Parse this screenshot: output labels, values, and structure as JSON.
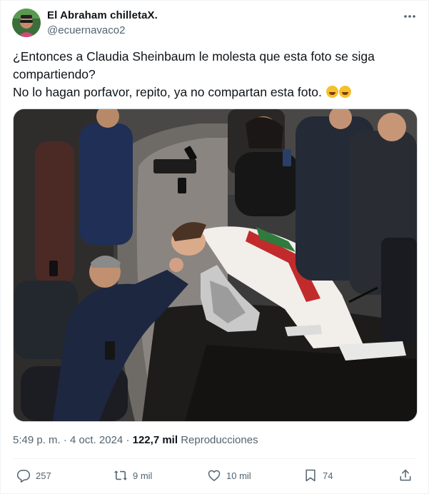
{
  "user": {
    "display_name": "El Abraham chilletaX.",
    "handle": "@ecuernavaco2"
  },
  "tweet": {
    "line1": "¿Entonces a Claudia Sheinbaum le molesta que esta foto se siga",
    "line2": "compartiendo?",
    "line3": "No lo hagan porfavor, repito, ya no compartan esta foto.",
    "emojis": [
      "rolling-on-floor-laughing-icon",
      "rolling-on-floor-laughing-icon"
    ]
  },
  "meta": {
    "time": "5:49 p. m.",
    "separator1": "·",
    "date": "4 oct. 2024",
    "separator2": "·",
    "views_count": "122,7 mil",
    "views_label": "Reproducciones"
  },
  "actions": {
    "replies": "257",
    "retweets": "9 mil",
    "likes": "10 mil",
    "bookmarks": "74"
  },
  "colors": {
    "text": "#0f1419",
    "secondary": "#536471",
    "border": "#eff3f4"
  }
}
